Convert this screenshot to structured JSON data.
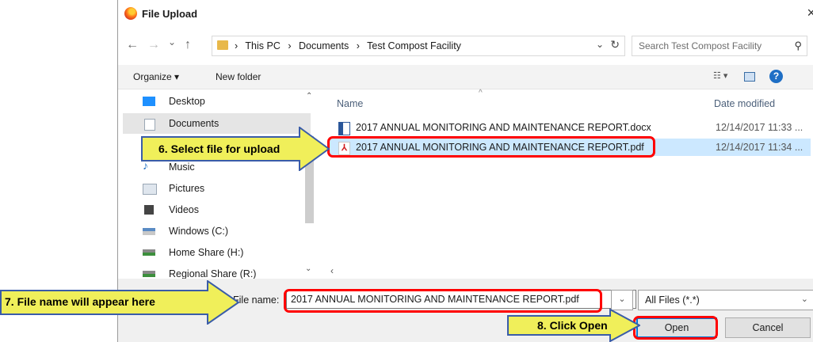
{
  "dialog": {
    "title": "File Upload",
    "close_glyph": "×"
  },
  "nav": {
    "back": "←",
    "forward": "→",
    "recent": "⌄",
    "up": "↑",
    "crumbs": [
      "›",
      "This PC",
      "›",
      "Documents",
      "›",
      "Test Compost Facility"
    ],
    "dropdown": "⌄",
    "refresh": "↻",
    "search_placeholder": "Search Test Compost Facility"
  },
  "toolbar": {
    "organize_label": "Organize ▾",
    "new_folder_label": "New folder",
    "help_label": "?"
  },
  "sidebar": {
    "items": [
      {
        "label": "Desktop",
        "icon": "desktop-icon",
        "color": "#1e90ff"
      },
      {
        "label": "Documents",
        "icon": "documents-icon",
        "color": "#9aa7b5"
      },
      {
        "label": "Music",
        "icon": "music-icon",
        "color": "#1f6fc5"
      },
      {
        "label": "Pictures",
        "icon": "pictures-icon",
        "color": "#9aa7b5"
      },
      {
        "label": "Videos",
        "icon": "videos-icon",
        "color": "#444444"
      },
      {
        "label": "Windows (C:)",
        "icon": "drive-icon",
        "color": "#5a8bc4"
      },
      {
        "label": "Home Share (H:)",
        "icon": "network-drive-icon",
        "color": "#3c8f3c"
      },
      {
        "label": "Regional Share (R:)",
        "icon": "network-drive-icon",
        "color": "#3c8f3c"
      }
    ]
  },
  "file_list": {
    "col_name": "Name",
    "col_date": "Date modified",
    "rows": [
      {
        "name": "2017 ANNUAL MONITORING AND MAINTENANCE REPORT.docx",
        "date": "12/14/2017 11:33 ...",
        "type": "docx",
        "selected": false
      },
      {
        "name": "2017 ANNUAL MONITORING AND MAINTENANCE REPORT.pdf",
        "date": "12/14/2017 11:34 ...",
        "type": "pdf",
        "selected": true
      }
    ]
  },
  "bottom": {
    "file_name_label": "File name:",
    "file_name_value": "2017 ANNUAL MONITORING AND MAINTENANCE REPORT.pdf",
    "file_type_value": "All Files (*.*)",
    "open_label": "Open",
    "cancel_label": "Cancel"
  },
  "annotations": {
    "step6": "6. Select file for upload",
    "step7": "7. File name will appear here",
    "step8": "8. Click Open",
    "callout_fill": "#f0ef5a",
    "callout_border": "#3a5ca8",
    "highlight_color": "#ff0000"
  }
}
